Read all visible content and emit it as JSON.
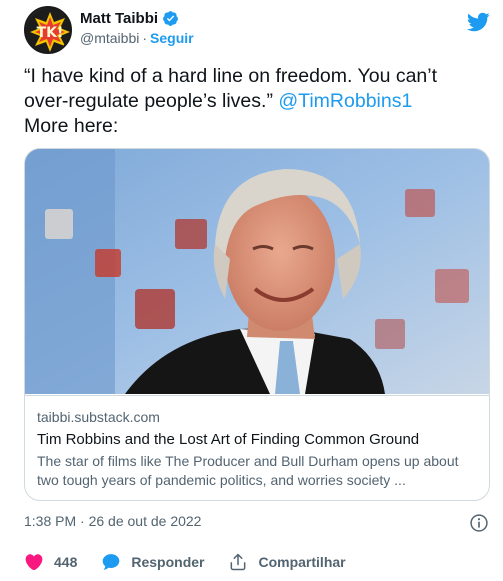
{
  "author": {
    "name": "Matt Taibbi",
    "handle": "@mtaibbi",
    "separator": "·",
    "follow_label": "Seguir",
    "avatar_text": "TK!"
  },
  "tweet": {
    "text_before": "“I have kind of a hard line on freedom. You can’t over-regulate people’s lives.” ",
    "mention": "@TimRobbins1",
    "text_after": "More here:"
  },
  "card": {
    "domain": "taibbi.substack.com",
    "title": "Tim Robbins and the Lost Art of Finding Common Ground",
    "description": "The star of films like The Producer and Bull Durham opens up about two tough years of pandemic politics, and worries society ..."
  },
  "timestamp": "1:38 PM · 26 de out de 2022",
  "actions": {
    "likes": "448",
    "reply_label": "Responder",
    "share_label": "Compartilhar"
  },
  "colors": {
    "accent": "#1d9bf0",
    "like": "#f91880",
    "text": "#0f1419",
    "secondary": "#536471"
  },
  "icons": [
    "verified-badge-icon",
    "twitter-bird-icon",
    "info-icon",
    "heart-icon",
    "reply-bubble-icon",
    "share-icon"
  ]
}
